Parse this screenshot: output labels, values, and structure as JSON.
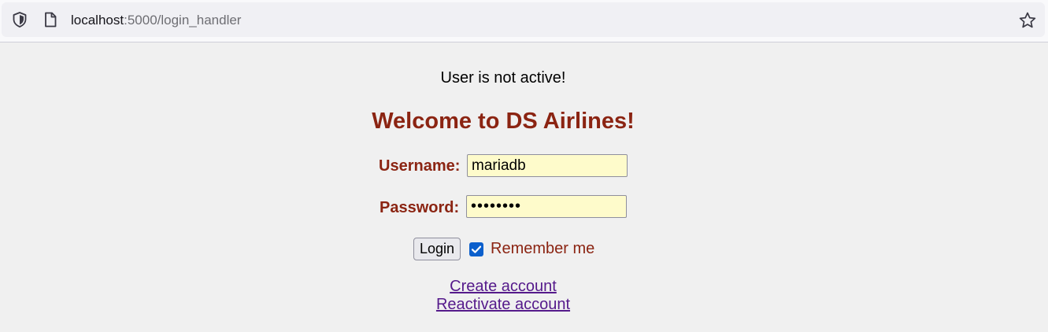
{
  "browser": {
    "url_host": "localhost",
    "url_path": ":5000/login_handler",
    "icons": [
      "shield-icon",
      "page-icon",
      "star-icon"
    ]
  },
  "page": {
    "notice": "User is not active!",
    "title": "Welcome to DS Airlines!",
    "username_label": "Username:",
    "username_value": "mariadb",
    "password_label": "Password:",
    "password_display": "••••••••",
    "login_label": "Login",
    "remember_checked": true,
    "remember_label": "Remember me",
    "create_account_label": "Create account",
    "reactivate_account_label": "Reactivate account"
  },
  "colors": {
    "brand": "#8b2412",
    "link": "#551a8b",
    "input_bg": "#fefbcb",
    "checkbox": "#0b5fcc",
    "page_bg": "#f0f0f0"
  }
}
